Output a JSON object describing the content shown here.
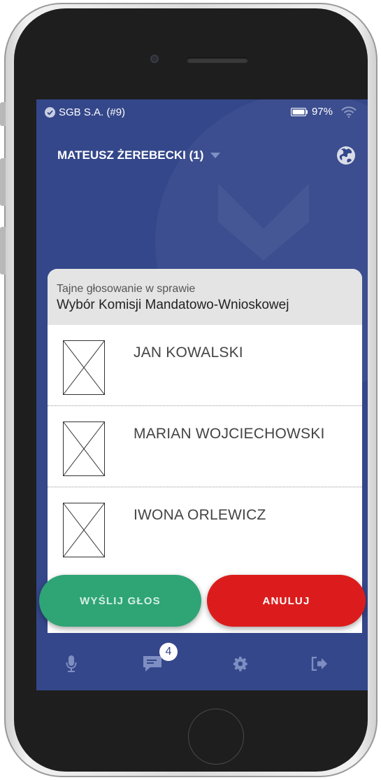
{
  "status_bar": {
    "carrier": "SGB S.A. (#9)",
    "battery": "97%"
  },
  "header": {
    "user_name": "MATEUSZ ŻEREBECKI (1)"
  },
  "dialog": {
    "subtitle": "Tajne głosowanie w sprawie",
    "title": "Wybór Komisji Mandatowo-Wnioskowej",
    "candidates": [
      {
        "name": "JAN KOWALSKI",
        "checked": false
      },
      {
        "name": "MARIAN WOJCIECHOWSKI",
        "checked": false
      },
      {
        "name": "IWONA ORLEWICZ",
        "checked": false
      }
    ]
  },
  "actions": {
    "send_label": "WYŚLIJ GŁOS",
    "cancel_label": "ANULUJ"
  },
  "tabbar": {
    "messages_badge": "4"
  },
  "colors": {
    "background": "#34478a",
    "send_button": "#2fa475",
    "cancel_button": "#dc1c1c",
    "dialog_header": "#e4e4e4"
  },
  "icons": [
    "check-circle-icon",
    "battery-icon",
    "wifi-icon",
    "dropdown-caret-icon",
    "globe-icon",
    "microphone-icon",
    "chat-icon",
    "gear-icon",
    "logout-icon"
  ]
}
